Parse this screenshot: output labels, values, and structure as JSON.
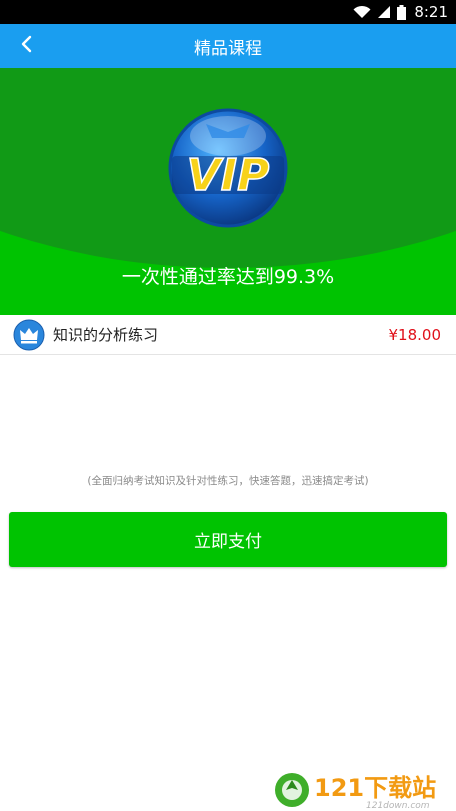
{
  "statusbar": {
    "time": "8:21",
    "icons": [
      "wifi-icon",
      "signal-icon",
      "battery-icon"
    ]
  },
  "header": {
    "title": "精品课程",
    "back_icon": "chevron-left-icon"
  },
  "hero": {
    "badge_text": "VIP",
    "pass_rate": "一次性通过率达到99.3%"
  },
  "course": {
    "icon": "crown-icon",
    "name": "知识的分析练习",
    "price": "¥18.00"
  },
  "description": "(全面归纳考试知识及针对性练习，快速答题，迅速搞定考试)",
  "pay_button": {
    "label": "立即支付"
  },
  "watermark": {
    "text": "121下载站",
    "sub_text": "121down.com"
  },
  "colors": {
    "title_bar": "#1a9ef0",
    "accent_green": "#00c301",
    "dark_green": "#119a16",
    "price_red": "#e0101a",
    "vip_blue": "#1664c8",
    "vip_yellow": "#f7d21a"
  }
}
